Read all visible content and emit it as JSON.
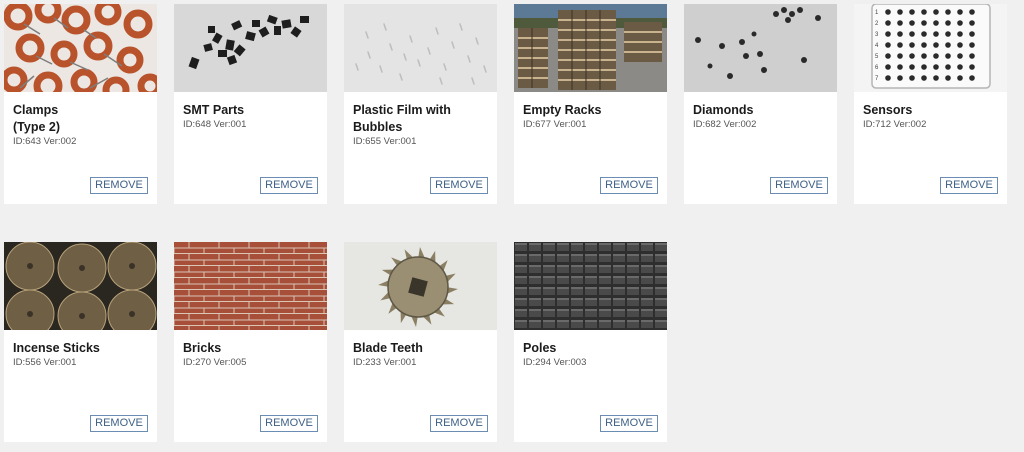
{
  "remove_label": "REMOVE",
  "cards": [
    {
      "title_lines": [
        "Clamps",
        "(Type 2)"
      ],
      "meta": "ID:643 Ver:002"
    },
    {
      "title_lines": [
        "SMT Parts"
      ],
      "meta": "ID:648 Ver:001"
    },
    {
      "title_lines": [
        "Plastic Film with",
        "Bubbles"
      ],
      "meta": "ID:655 Ver:001"
    },
    {
      "title_lines": [
        "Empty Racks"
      ],
      "meta": "ID:677 Ver:001"
    },
    {
      "title_lines": [
        "Diamonds"
      ],
      "meta": "ID:682 Ver:002"
    },
    {
      "title_lines": [
        "Sensors"
      ],
      "meta": "ID:712 Ver:002"
    },
    {
      "title_lines": [
        "Incense Sticks"
      ],
      "meta": "ID:556 Ver:001"
    },
    {
      "title_lines": [
        "Bricks"
      ],
      "meta": "ID:270 Ver:005"
    },
    {
      "title_lines": [
        "Blade Teeth"
      ],
      "meta": "ID:233 Ver:001"
    },
    {
      "title_lines": [
        "Poles"
      ],
      "meta": "ID:294 Ver:003"
    }
  ],
  "sensor_tray_row_numbers": [
    "1",
    "2",
    "3",
    "4",
    "5",
    "6",
    "7"
  ]
}
